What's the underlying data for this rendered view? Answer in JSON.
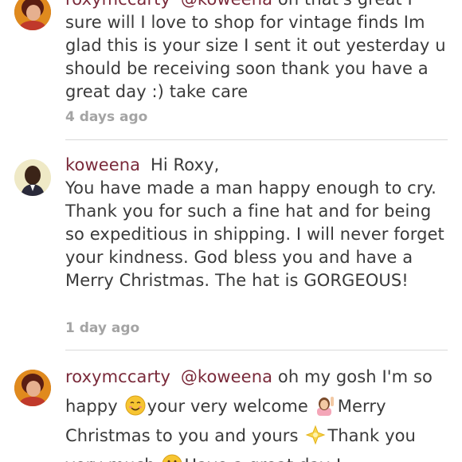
{
  "comments": [
    {
      "username": "roxymccarty",
      "mention": "@koweena",
      "text_line1_tail": "oh that's great I",
      "text_rest": "sure will I love to shop for vintage finds Im glad this is your size I sent it out yesterday u should be receiving soon thank you have a great day :) take care",
      "time": "4 days ago"
    },
    {
      "username": "koweena",
      "text_line1_tail": "Hi Roxy,",
      "text_rest": "You have made a man happy enough to cry. Thank you for such a fine hat and for being so expeditious in shipping. I will never forget your kindness. God bless you and have a Merry Christmas. The hat is GORGEOUS!",
      "time": "1 day ago"
    },
    {
      "username": "roxymccarty",
      "mention": "@koweena",
      "text_part1": "oh my gosh I'm so happy",
      "text_part2": "your very welcome",
      "text_part3": "Merry Christmas to you and yours",
      "text_part4": "Thank you very much",
      "text_part5": "Have a great day !"
    }
  ],
  "icons": {
    "smile": "smiling-face-emoji",
    "woman": "woman-raising-hand-emoji",
    "star": "glowing-star-emoji",
    "grin": "grinning-face-emoji"
  }
}
